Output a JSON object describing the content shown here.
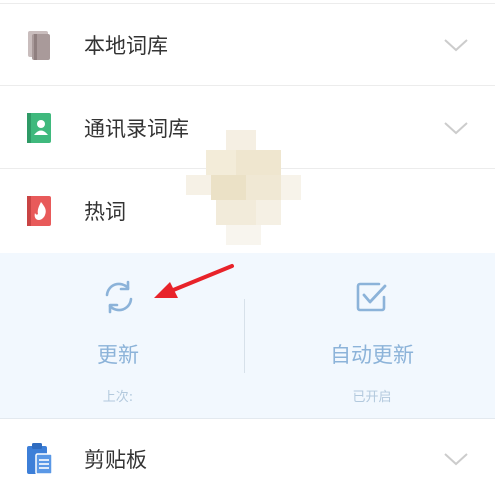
{
  "rows": {
    "local": {
      "label": "本地词库",
      "icon": "book-icon",
      "color": "#b4a7a7"
    },
    "contacts": {
      "label": "通讯录词库",
      "icon": "contacts-book-icon",
      "color": "#3fb97d"
    },
    "hot": {
      "label": "热词",
      "icon": "flame-book-icon",
      "color": "#e85a5a"
    },
    "clipboard": {
      "label": "剪贴板",
      "icon": "clipboard-icon",
      "color": "#3d7fd8"
    }
  },
  "update_panel": {
    "update": {
      "label": "更新",
      "sub": "上次:",
      "icon": "refresh-icon"
    },
    "auto_update": {
      "label": "自动更新",
      "sub": "已开启",
      "icon": "checkbox-checked-icon"
    }
  },
  "colors": {
    "accent": "#8cb3d9",
    "panel_bg": "#f2f8fe",
    "arrow": "#e8232a",
    "chevron": "#cccccc"
  }
}
